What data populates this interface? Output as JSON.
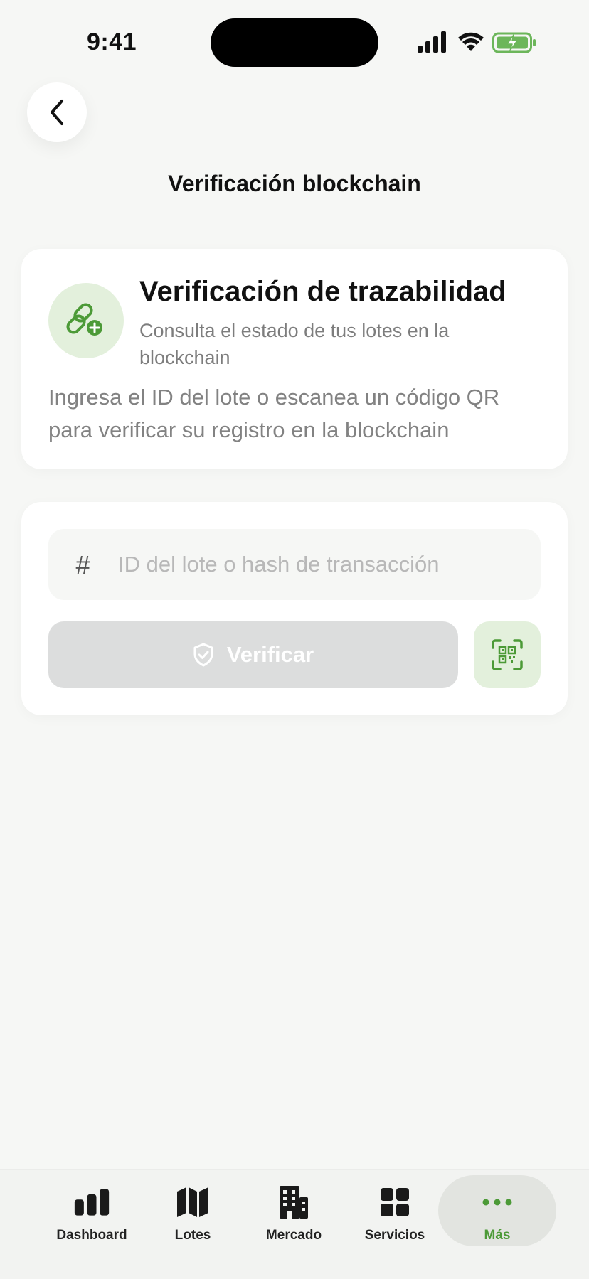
{
  "status_bar": {
    "time": "9:41"
  },
  "header": {
    "title": "Verificación blockchain",
    "back_icon": "chevron-left-icon"
  },
  "info_card": {
    "icon": "link-plus-icon",
    "title": "Verificación de trazabilidad",
    "subtitle": "Consulta el estado de tus lotes en la blockchain",
    "description": "Ingresa el ID del lote o escanea un código QR para verificar su registro en la blockchain"
  },
  "form": {
    "hash_symbol": "#",
    "input_placeholder": "ID del lote o hash de transacción",
    "input_value": "",
    "verify_label": "Verificar",
    "verify_icon": "shield-check-icon",
    "qr_icon": "qr-scan-icon"
  },
  "nav": {
    "items": [
      {
        "label": "Dashboard",
        "icon": "bar-chart-icon"
      },
      {
        "label": "Lotes",
        "icon": "map-icon"
      },
      {
        "label": "Mercado",
        "icon": "building-icon"
      },
      {
        "label": "Servicios",
        "icon": "grid-icon"
      },
      {
        "label": "Más",
        "icon": "more-dots-icon",
        "active": true
      }
    ]
  },
  "colors": {
    "accent": "#4c9a37",
    "accent_light": "#e3f0dc",
    "background": "#f6f7f5",
    "disabled_button": "#dcdddd"
  }
}
